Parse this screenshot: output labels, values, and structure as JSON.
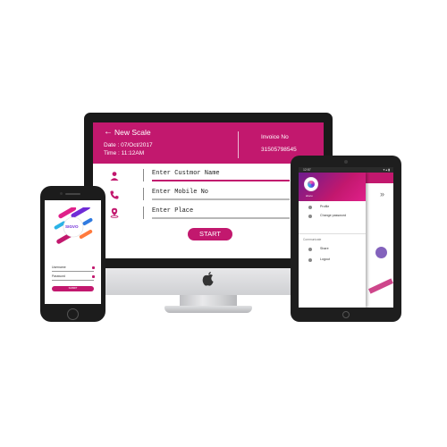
{
  "colors": {
    "accent": "#c2186e",
    "dark_frame": "#1a1a1a",
    "silver": "#d0d1d4"
  },
  "desktop": {
    "back_icon": "arrow-left-icon",
    "title": "New Scale",
    "date_text": "Date :  07/Oct/2017",
    "time_text": "Time : 11:12AM",
    "invoice_label": "Invoice No",
    "invoice_number": "31505798545",
    "fields": [
      {
        "icon": "user-icon",
        "placeholder": "Enter Custmor Name"
      },
      {
        "icon": "phone-icon",
        "placeholder": "Enter Mobile No"
      },
      {
        "icon": "location-pin-icon",
        "placeholder": "Enter Place"
      }
    ],
    "start_label": "START"
  },
  "phone": {
    "splash_text": "SIGVO",
    "username_label": "Username",
    "password_label": "Password",
    "submit_label": "SUBMIT"
  },
  "tablet": {
    "status_time": "12:57",
    "status_icons": "▾ ▴ ▮",
    "user_label": "sharu",
    "menu": [
      {
        "icon": "user-icon",
        "label": "Profile"
      },
      {
        "icon": "lock-icon",
        "label": "Change password"
      }
    ],
    "section_label": "Communicate",
    "comm": [
      {
        "icon": "share-icon",
        "label": "Share"
      },
      {
        "icon": "logout-icon",
        "label": "Logout"
      }
    ],
    "chevron": "»"
  }
}
